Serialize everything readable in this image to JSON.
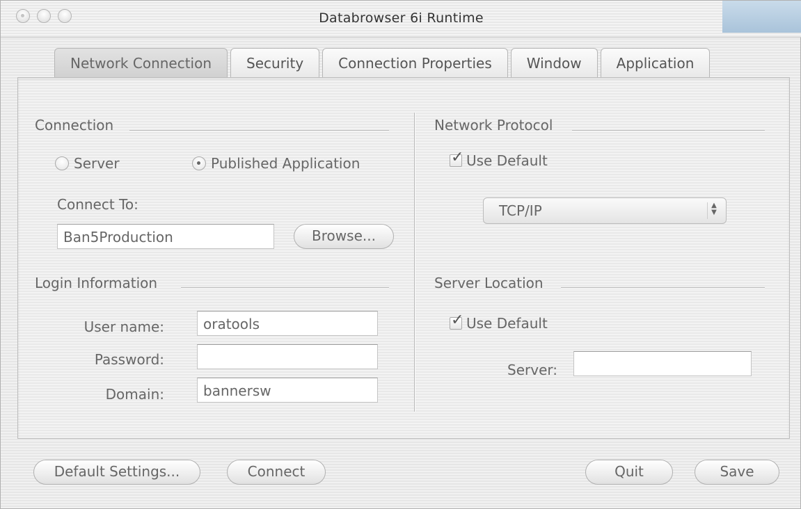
{
  "window": {
    "title": "Databrowser 6i Runtime"
  },
  "tabs": [
    {
      "label": "Network Connection",
      "active": true
    },
    {
      "label": "Security",
      "active": false
    },
    {
      "label": "Connection Properties",
      "active": false
    },
    {
      "label": "Window",
      "active": false
    },
    {
      "label": "Application",
      "active": false
    }
  ],
  "connection": {
    "title": "Connection",
    "server_label": "Server",
    "published_label": "Published Application",
    "selected": "Published Application",
    "connect_to_label": "Connect To:",
    "connect_to_value": "Ban5Production",
    "browse_label": "Browse..."
  },
  "login": {
    "title": "Login Information",
    "username_label": "User name:",
    "username_value": "oratools",
    "password_label": "Password:",
    "password_value": "",
    "domain_label": "Domain:",
    "domain_value": "bannersw"
  },
  "network_protocol": {
    "title": "Network Protocol",
    "use_default_label": "Use Default",
    "use_default_checked": true,
    "protocol_value": "TCP/IP"
  },
  "server_location": {
    "title": "Server Location",
    "use_default_label": "Use Default",
    "use_default_checked": true,
    "server_label": "Server:",
    "server_value": ""
  },
  "footer": {
    "default_settings_label": "Default Settings...",
    "connect_label": "Connect",
    "quit_label": "Quit",
    "save_label": "Save"
  }
}
